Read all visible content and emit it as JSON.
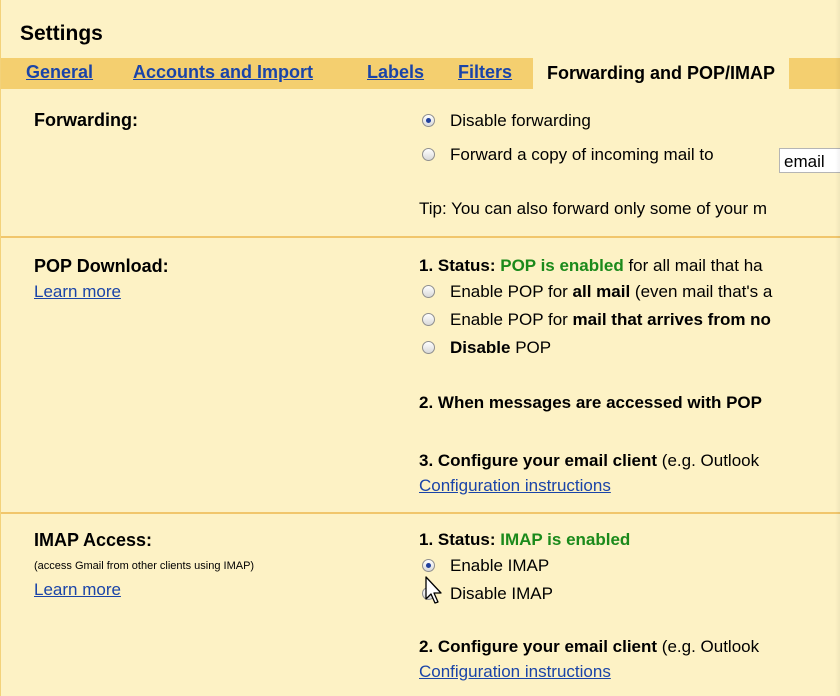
{
  "header": {
    "title": "Settings"
  },
  "tabs": [
    {
      "label": "General"
    },
    {
      "label": "Accounts and Import"
    },
    {
      "label": "Labels"
    },
    {
      "label": "Filters"
    },
    {
      "label": "Forwarding and POP/IMAP",
      "active": true
    }
  ],
  "forwarding": {
    "label": "Forwarding:",
    "option_disable": "Disable forwarding",
    "option_forward": "Forward a copy of incoming mail to",
    "email_value": "email",
    "tip": "Tip: You can also forward only some of your m"
  },
  "pop": {
    "label": "POP Download:",
    "learn_more": "Learn more",
    "status_prefix": "1. Status: ",
    "status_value": "POP is enabled",
    "status_suffix": " for all mail that ha",
    "opt1_pre": "Enable POP for ",
    "opt1_bold": "all mail",
    "opt1_post": " (even mail that's a",
    "opt2_pre": "Enable POP for ",
    "opt2_bold": "mail that arrives from no",
    "opt3_bold": "Disable",
    "opt3_post": " POP",
    "step2": "2. When messages are accessed with POP",
    "step3_bold": "3. Configure your email client",
    "step3_rest": " (e.g. Outlook",
    "config_link": "Configuration instructions"
  },
  "imap": {
    "label": "IMAP Access:",
    "subtext": "(access Gmail from other clients using IMAP)",
    "learn_more": "Learn more",
    "status_prefix": "1. Status: ",
    "status_value": "IMAP is enabled",
    "opt_enable": "Enable IMAP",
    "opt_disable": "Disable IMAP",
    "step2_bold": "2. Configure your email client",
    "step2_rest": " (e.g. Outlook",
    "config_link": "Configuration instructions"
  },
  "colors": {
    "background": "#fdf2c5",
    "tab_bar": "#f4cf6f",
    "link": "#1a44a8",
    "status_green": "#1b8a1b"
  }
}
